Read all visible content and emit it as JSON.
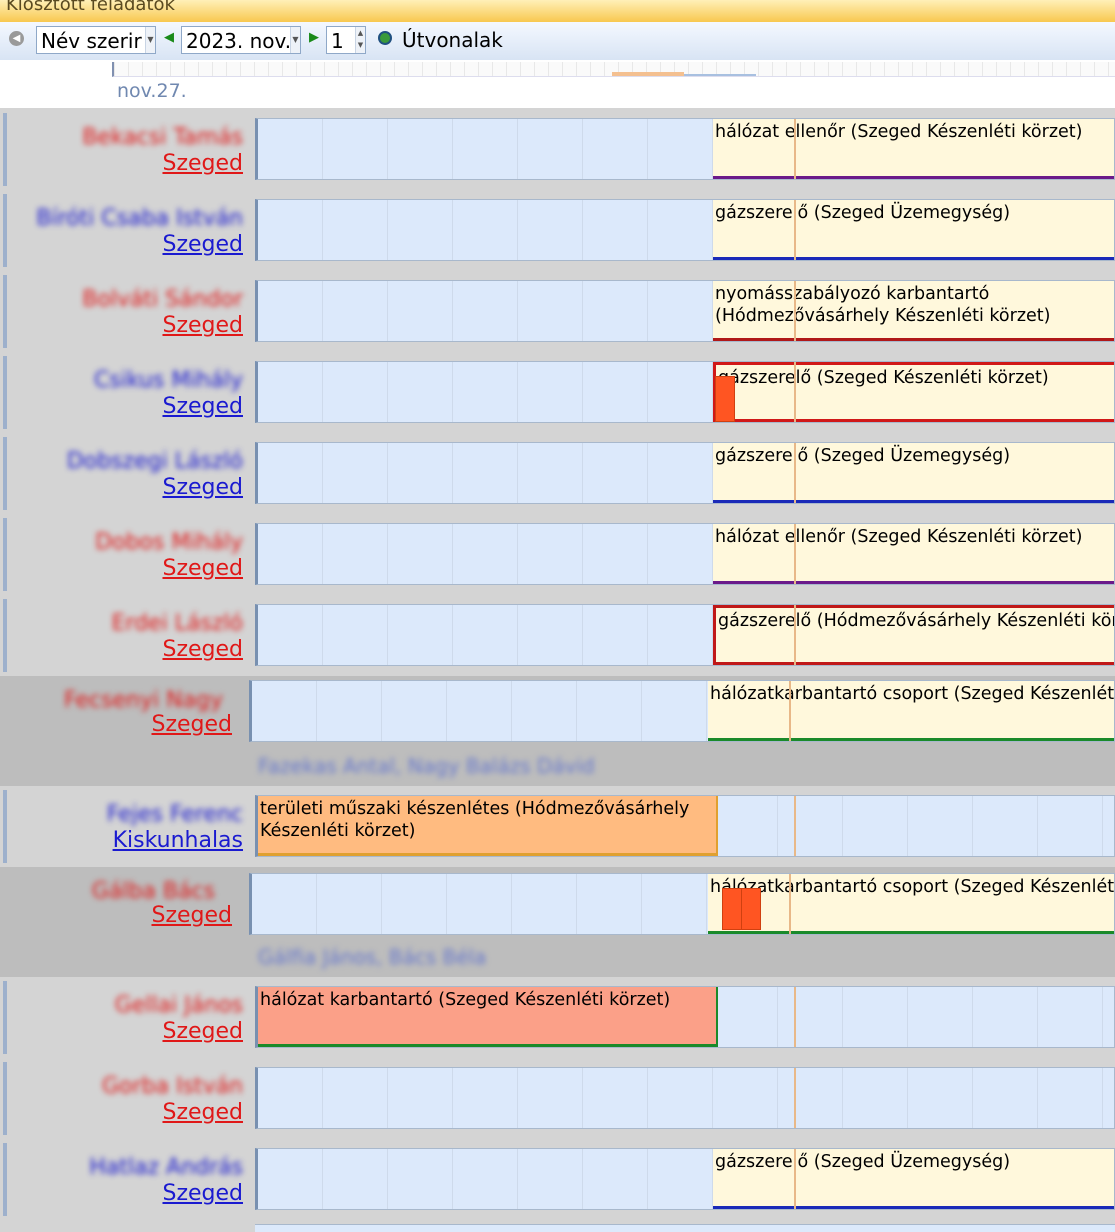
{
  "window": {
    "title": "Kiosztott feladatok"
  },
  "toolbar": {
    "sort_value": "Név szerir",
    "date_value": "2023. nov.",
    "day_value": "1",
    "routes_label": "Útvonalak"
  },
  "ruler": {
    "date_label": "nov.27."
  },
  "rows": [
    {
      "name": "Bekacsi Tamás",
      "city": "Szeged",
      "task": "hálózat ellenőr (Szeged Készenléti körzet)"
    },
    {
      "name": "Bíróti Csaba István",
      "city": "Szeged",
      "task": "gázszerelő (Szeged Üzemegység)"
    },
    {
      "name": "Bolváti Sándor",
      "city": "Szeged",
      "task": "nyomásszabályozó karbantartó (Hódmezővásárhely Készenléti körzet)"
    },
    {
      "name": "Csikus Mihály",
      "city": "Szeged",
      "task": "gázszerelő (Szeged Készenléti körzet)"
    },
    {
      "name": "Dobszegi László",
      "city": "Szeged",
      "task": "gázszerelő (Szeged Üzemegység)"
    },
    {
      "name": "Dobos Mihály",
      "city": "Szeged",
      "task": "hálózat ellenőr (Szeged Készenléti körzet)"
    },
    {
      "name": "Erdei László",
      "city": "Szeged",
      "task": "gázszerelő (Hódmezővásárhely Készenléti körzet)"
    },
    {
      "name": "Fecsenyi Nagy",
      "city": "Szeged",
      "task": "hálózatkarbantartó csoport (Szeged Készenléti körzet)",
      "members": "Fazekas Antal, Nagy Balázs Dávid"
    },
    {
      "name": "Fejes Ferenc",
      "city": "Kiskunhalas",
      "task": "területi műszaki készenlétes (Hódmezővásárhely Készenléti körzet)"
    },
    {
      "name": "Gálba Bács",
      "city": "Szeged",
      "task": "hálózatkarbantartó csoport (Szeged Készenléti körzet)",
      "members": "Gálfia János, Bács Béla"
    },
    {
      "name": "Gellai János",
      "city": "Szeged",
      "task": "hálózat karbantartó (Szeged Készenléti körzet)"
    },
    {
      "name": "Gorba István",
      "city": "Szeged",
      "task": ""
    },
    {
      "name": "Hatlaz András",
      "city": "Szeged",
      "task": "gázszerelő (Szeged Üzemegység)"
    }
  ],
  "colors": {
    "red_name": "#e01818",
    "blue_name": "#1a1ad0",
    "lane": "#dce9fb",
    "task_bg": "#fff8dc"
  }
}
